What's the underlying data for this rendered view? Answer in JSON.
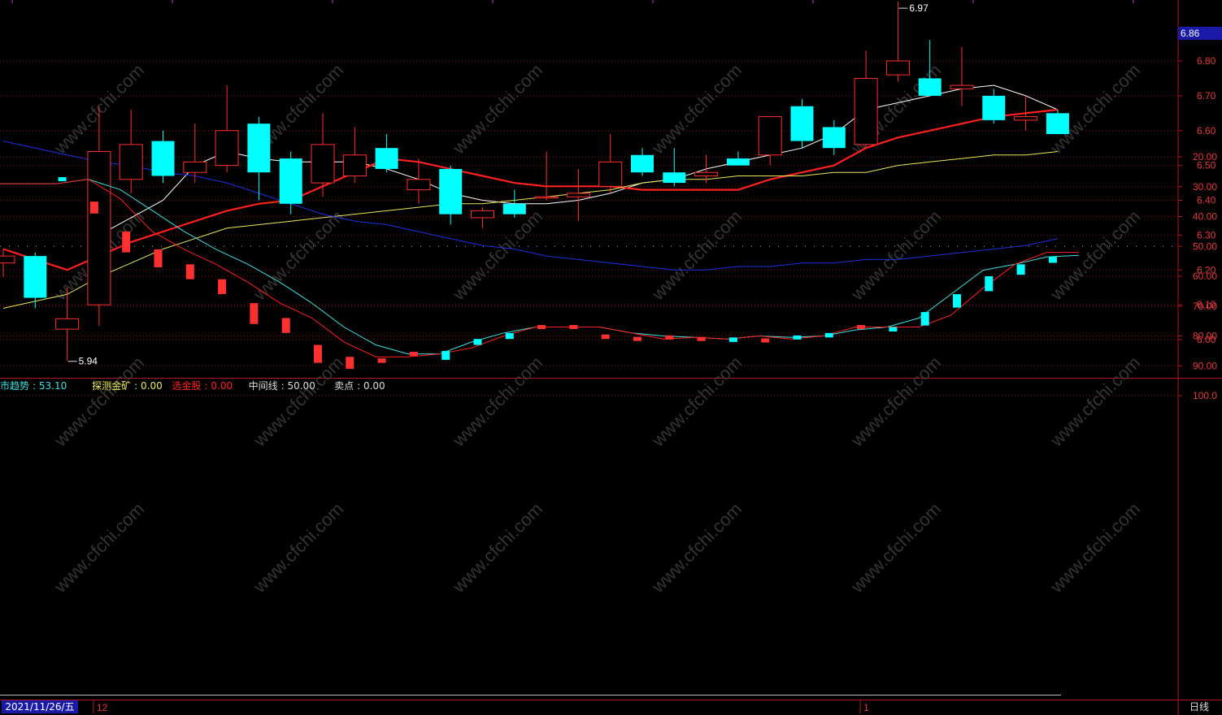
{
  "chart_data": [
    {
      "type": "candlestick",
      "title": "",
      "period": "日线",
      "current_price": "6.86",
      "yticks": [
        "6.80",
        "6.70",
        "6.60",
        "6.50",
        "6.40",
        "6.30",
        "6.20",
        "6.10",
        "6.00"
      ],
      "ylim": [
        5.92,
        6.86
      ],
      "candles": [
        {
          "o": 6.22,
          "h": 6.26,
          "l": 6.18,
          "c": 6.24
        },
        {
          "o": 6.24,
          "h": 6.25,
          "l": 6.09,
          "c": 6.12
        },
        {
          "o": 6.03,
          "h": 6.15,
          "l": 5.94,
          "c": 6.06
        },
        {
          "o": 6.1,
          "h": 6.67,
          "l": 6.04,
          "c": 6.54
        },
        {
          "o": 6.46,
          "h": 6.66,
          "l": 6.42,
          "c": 6.56
        },
        {
          "o": 6.57,
          "h": 6.6,
          "l": 6.45,
          "c": 6.47
        },
        {
          "o": 6.48,
          "h": 6.62,
          "l": 6.45,
          "c": 6.51
        },
        {
          "o": 6.5,
          "h": 6.73,
          "l": 6.48,
          "c": 6.6
        },
        {
          "o": 6.62,
          "h": 6.64,
          "l": 6.4,
          "c": 6.48
        },
        {
          "o": 6.52,
          "h": 6.54,
          "l": 6.36,
          "c": 6.39
        },
        {
          "o": 6.45,
          "h": 6.65,
          "l": 6.41,
          "c": 6.56
        },
        {
          "o": 6.47,
          "h": 6.61,
          "l": 6.45,
          "c": 6.53
        },
        {
          "o": 6.55,
          "h": 6.59,
          "l": 6.48,
          "c": 6.49
        },
        {
          "o": 6.43,
          "h": 6.52,
          "l": 6.39,
          "c": 6.46
        },
        {
          "o": 6.49,
          "h": 6.5,
          "l": 6.33,
          "c": 6.36
        },
        {
          "o": 6.35,
          "h": 6.38,
          "l": 6.32,
          "c": 6.37
        },
        {
          "o": 6.39,
          "h": 6.43,
          "l": 6.35,
          "c": 6.36
        },
        {
          "o": 6.41,
          "h": 6.54,
          "l": 6.4,
          "c": 6.41
        },
        {
          "o": 6.41,
          "h": 6.49,
          "l": 6.34,
          "c": 6.42
        },
        {
          "o": 6.44,
          "h": 6.59,
          "l": 6.42,
          "c": 6.51
        },
        {
          "o": 6.53,
          "h": 6.55,
          "l": 6.47,
          "c": 6.48
        },
        {
          "o": 6.48,
          "h": 6.55,
          "l": 6.44,
          "c": 6.45
        },
        {
          "o": 6.47,
          "h": 6.53,
          "l": 6.45,
          "c": 6.48
        },
        {
          "o": 6.52,
          "h": 6.54,
          "l": 6.5,
          "c": 6.5
        },
        {
          "o": 6.53,
          "h": 6.63,
          "l": 6.5,
          "c": 6.64
        },
        {
          "o": 6.67,
          "h": 6.69,
          "l": 6.55,
          "c": 6.57
        },
        {
          "o": 6.61,
          "h": 6.63,
          "l": 6.53,
          "c": 6.55
        },
        {
          "o": 6.56,
          "h": 6.83,
          "l": 6.55,
          "c": 6.75
        },
        {
          "o": 6.76,
          "h": 6.97,
          "l": 6.74,
          "c": 6.8
        },
        {
          "o": 6.75,
          "h": 6.86,
          "l": 6.7,
          "c": 6.7
        },
        {
          "o": 6.72,
          "h": 6.84,
          "l": 6.67,
          "c": 6.73
        },
        {
          "o": 6.7,
          "h": 6.72,
          "l": 6.62,
          "c": 6.63
        },
        {
          "o": 6.63,
          "h": 6.7,
          "l": 6.6,
          "c": 6.64
        },
        {
          "o": 6.65,
          "h": 6.66,
          "l": 6.59,
          "c": 6.59
        }
      ],
      "ma_series": [
        {
          "color": "#ffffff",
          "values": [
            null,
            null,
            null,
            6.3,
            6.35,
            6.4,
            6.5,
            6.54,
            6.52,
            6.51,
            6.51,
            6.51,
            6.49,
            6.46,
            6.42,
            6.4,
            6.39,
            6.39,
            6.4,
            6.42,
            6.45,
            6.46,
            6.49,
            6.51,
            6.53,
            6.55,
            6.59,
            6.66,
            6.68,
            6.7,
            6.72,
            6.73,
            6.7,
            6.66
          ]
        },
        {
          "color": "#ff2020",
          "values": [
            6.26,
            6.23,
            6.2,
            6.24,
            6.28,
            6.31,
            6.34,
            6.37,
            6.39,
            6.4,
            6.44,
            6.48,
            6.52,
            6.51,
            6.49,
            6.47,
            6.45,
            6.44,
            6.44,
            6.44,
            6.43,
            6.43,
            6.43,
            6.43,
            6.46,
            6.48,
            6.5,
            6.55,
            6.58,
            6.6,
            6.62,
            6.64,
            6.65,
            6.66
          ]
        },
        {
          "color": "#e8e860",
          "values": [
            6.09,
            6.11,
            6.13,
            6.18,
            6.22,
            6.26,
            6.29,
            6.32,
            6.33,
            6.34,
            6.35,
            6.36,
            6.37,
            6.38,
            6.39,
            6.39,
            6.4,
            6.41,
            6.42,
            6.43,
            6.45,
            6.46,
            6.46,
            6.47,
            6.47,
            6.47,
            6.48,
            6.48,
            6.5,
            6.51,
            6.52,
            6.53,
            6.53,
            6.54
          ]
        },
        {
          "color": "#2030e0",
          "values": [
            6.57,
            6.55,
            6.53,
            6.51,
            6.5,
            6.48,
            6.47,
            6.45,
            6.42,
            6.39,
            6.36,
            6.34,
            6.33,
            6.31,
            6.29,
            6.27,
            6.26,
            6.24,
            6.23,
            6.22,
            6.21,
            6.2,
            6.2,
            6.21,
            6.21,
            6.22,
            6.22,
            6.23,
            6.23,
            6.24,
            6.25,
            6.26,
            6.27,
            6.29
          ]
        }
      ],
      "annotations": [
        {
          "text": "6.97",
          "candle": 28,
          "y": 6.97,
          "position": "above-right"
        },
        {
          "text": "5.94",
          "candle": 2,
          "y": 5.94,
          "position": "below-right"
        }
      ],
      "x_labels": [
        {
          "text": "12",
          "candle": 3
        },
        {
          "text": "1",
          "candle": 27
        }
      ],
      "date_label": "2021/11/26/五"
    },
    {
      "type": "line",
      "title": "",
      "legend": [
        {
          "name": "市趋势",
          "value": "53.10",
          "color": "#40e0e0"
        },
        {
          "name": "探测金矿",
          "value": "0.00",
          "color": "#e8e860"
        },
        {
          "name": "选金股",
          "value": "0.00",
          "color": "#ff2020"
        },
        {
          "name": "中间线",
          "value": "50.00",
          "color": "#dddddd"
        },
        {
          "name": "卖点",
          "value": "0.00",
          "color": "#dddddd"
        }
      ],
      "yticks": [
        "100.0",
        "90.00",
        "80.00",
        "70.00",
        "60.00",
        "50.00",
        "40.00",
        "30.00",
        "20.00"
      ],
      "ylim": [
        15,
        102
      ],
      "midline": 50,
      "series": [
        {
          "name": "市趋势",
          "color": "#40e0e0",
          "values": [
            29,
            29,
            27.5,
            31,
            38,
            45,
            51,
            56,
            62,
            69,
            77,
            83,
            86,
            86,
            82,
            79,
            77,
            77,
            77,
            79,
            80,
            80.5,
            81,
            80,
            80.5,
            80,
            78,
            77,
            74,
            66,
            58,
            56,
            53.5,
            53
          ]
        },
        {
          "name": "signal",
          "color": "#ff2020",
          "values": [
            29,
            29,
            27.5,
            34,
            45,
            51,
            56,
            62,
            69,
            74,
            82,
            87,
            87,
            86,
            84,
            80,
            77,
            77,
            77,
            79,
            81,
            80.5,
            81,
            80,
            81,
            80,
            77,
            77,
            77,
            73,
            64,
            56,
            52,
            52
          ]
        }
      ],
      "bars": [
        {
          "a": 27.5,
          "b": 27
        },
        {
          "a": 31,
          "b": 35
        },
        {
          "a": 38,
          "b": 45
        },
        {
          "a": 45,
          "b": 51
        },
        {
          "a": 51,
          "b": 56
        },
        {
          "a": 56,
          "b": 61
        },
        {
          "a": 62,
          "b": 69
        },
        {
          "a": 69,
          "b": 74
        },
        {
          "a": 77,
          "b": 83
        },
        {
          "a": 83,
          "b": 87
        },
        {
          "a": 86,
          "b": 87.5
        },
        {
          "a": 86,
          "b": 86
        },
        {
          "a": 85,
          "b": 82
        },
        {
          "a": 81,
          "b": 79
        },
        {
          "a": 79,
          "b": 77
        },
        {
          "a": 77,
          "b": 77
        },
        {
          "a": 77,
          "b": 77
        },
        {
          "a": 78,
          "b": 79.5
        },
        {
          "a": 80,
          "b": 81
        },
        {
          "a": 80.5,
          "b": 80.5
        },
        {
          "a": 80.5,
          "b": 81
        },
        {
          "a": 80.5,
          "b": 79
        },
        {
          "a": 80.5,
          "b": 81.5
        },
        {
          "a": 80.5,
          "b": 79.5
        },
        {
          "a": 79,
          "b": 77.5
        },
        {
          "a": 77,
          "b": 77
        },
        {
          "a": 77,
          "b": 75.5
        },
        {
          "a": 72,
          "b": 67.5
        },
        {
          "a": 66,
          "b": 61.5
        },
        {
          "a": 60,
          "b": 55
        },
        {
          "a": 56,
          "b": 52.5
        },
        {
          "a": 53.5,
          "b": 51.5
        }
      ]
    }
  ],
  "watermark": "www.cfchi.com",
  "colors": {
    "up": "#ff3030",
    "down": "#00ffff",
    "grid": "#7a1010",
    "border": "#b01818",
    "axis_text": "#e03c3c"
  }
}
